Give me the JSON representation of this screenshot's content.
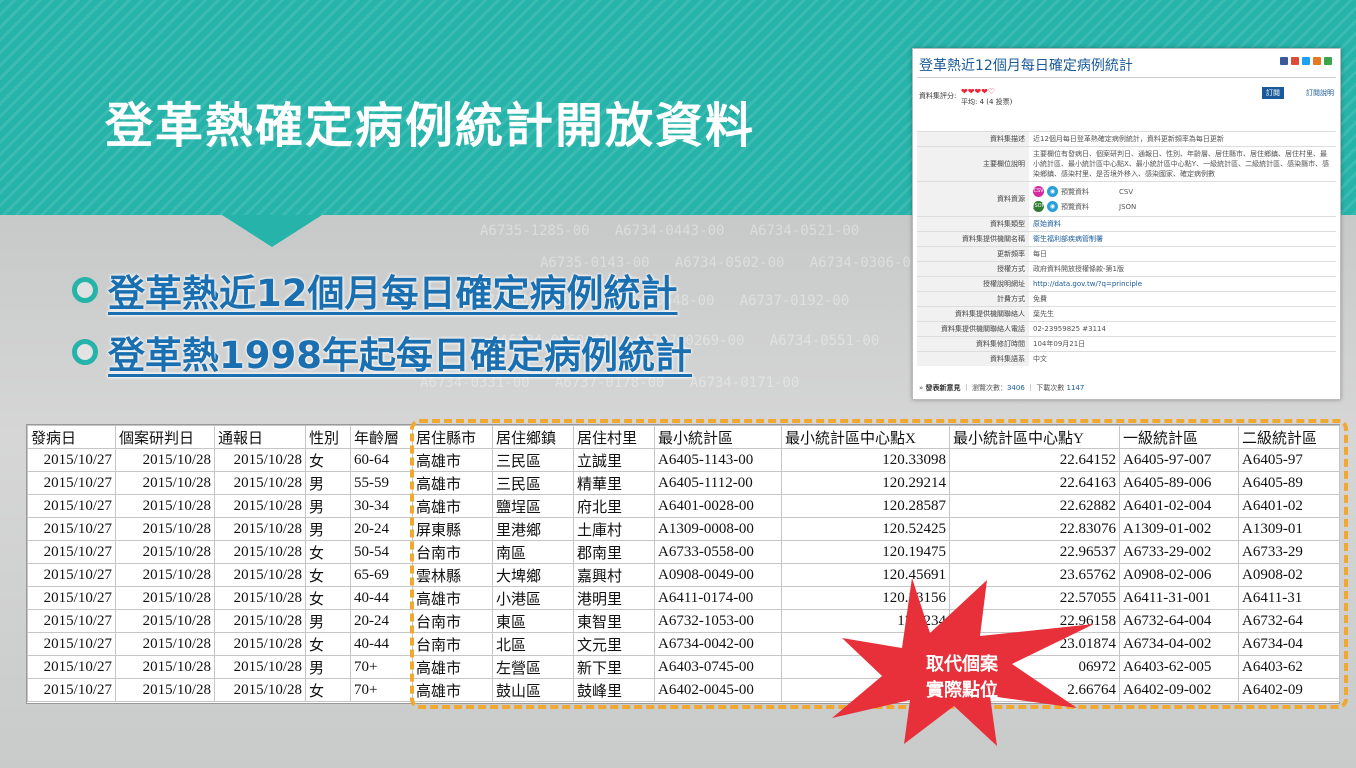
{
  "slide": {
    "title": "登革熱確定病例統計開放資料",
    "links": [
      "登革熱近12個月每日確定病例統計",
      "登革熱1998年起每日確定病例統計"
    ],
    "callout": [
      "取代個案",
      "實際點位"
    ],
    "colors": {
      "teal": "#26b3a9",
      "link": "#1a6fb0",
      "highlight_border": "#f0a830",
      "callout": "#e8303a"
    }
  },
  "dataset_panel": {
    "title": "登革熱近12個月每日確定病例統計",
    "rating_label": "資料集評分:",
    "rating_hearts": "❤❤❤❤♡",
    "rating_avg": "平均: 4 (4 投票)",
    "subscribe": "訂閱",
    "subscribe_help": "訂閱說明",
    "rows": [
      {
        "key": "資料集描述",
        "value": "近12個月每日登革熱確定病例統計，資料更新頻率為每日更新"
      },
      {
        "key": "主要欄位說明",
        "value": "主要欄位有發病日、個案研判日、通報日、性別、年齡層、居住縣市、居住鄉鎮、居住村里、最小統計區、最小統計區中心點X、最小統計區中心點Y、一級統計區、二級統計區、感染縣市、感染鄉鎮、感染村里、是否境外移入、感染國家、確定病例數"
      },
      {
        "key": "資料集類型",
        "value": "原始資料"
      },
      {
        "key": "資料集提供機關名稱",
        "value": "衛生福利部疾病管制署"
      },
      {
        "key": "更新頻率",
        "value": "每日"
      },
      {
        "key": "授權方式",
        "value": "政府資料開放授權條款-第1版"
      },
      {
        "key": "授權說明網址",
        "value": "http://data.gov.tw/?q=principle"
      },
      {
        "key": "計費方式",
        "value": "免費"
      },
      {
        "key": "資料集提供機關聯絡人",
        "value": "葉先生"
      },
      {
        "key": "資料集提供機關聯絡人電話",
        "value": "02-23959825 #3114"
      },
      {
        "key": "資料集修訂時間",
        "value": "104年09月21日"
      },
      {
        "key": "資料集語系",
        "value": "中文"
      }
    ],
    "resource_key": "資料資源",
    "resources": [
      {
        "badge": "CSV",
        "preview": "預覽資料",
        "format": "CSV"
      },
      {
        "badge": "JSON",
        "preview": "預覽資料",
        "format": "JSON"
      }
    ],
    "footer": {
      "comment": "發表新意見",
      "views_label": "瀏覽次數：",
      "views": "3406",
      "downloads_label": "下載次數",
      "downloads": "1147"
    }
  },
  "spreadsheet": {
    "headers": [
      "發病日",
      "個案研判日",
      "通報日",
      "性別",
      "年齡層",
      "居住縣市",
      "居住鄉鎮",
      "居住村里",
      "最小統計區",
      "最小統計區中心點X",
      "最小統計區中心點Y",
      "一級統計區",
      "二級統計區"
    ],
    "rows": [
      [
        "2015/10/27",
        "2015/10/28",
        "2015/10/28",
        "女",
        "60-64",
        "高雄市",
        "三民區",
        "立誠里",
        "A6405-1143-00",
        "120.33098",
        "22.64152",
        "A6405-97-007",
        "A6405-97"
      ],
      [
        "2015/10/27",
        "2015/10/28",
        "2015/10/28",
        "男",
        "55-59",
        "高雄市",
        "三民區",
        "精華里",
        "A6405-1112-00",
        "120.29214",
        "22.64163",
        "A6405-89-006",
        "A6405-89"
      ],
      [
        "2015/10/27",
        "2015/10/28",
        "2015/10/28",
        "男",
        "30-34",
        "高雄市",
        "鹽埕區",
        "府北里",
        "A6401-0028-00",
        "120.28587",
        "22.62882",
        "A6401-02-004",
        "A6401-02"
      ],
      [
        "2015/10/27",
        "2015/10/28",
        "2015/10/28",
        "男",
        "20-24",
        "屏東縣",
        "里港鄉",
        "土庫村",
        "A1309-0008-00",
        "120.52425",
        "22.83076",
        "A1309-01-002",
        "A1309-01"
      ],
      [
        "2015/10/27",
        "2015/10/28",
        "2015/10/28",
        "女",
        "50-54",
        "台南市",
        "南區",
        "郡南里",
        "A6733-0558-00",
        "120.19475",
        "22.96537",
        "A6733-29-002",
        "A6733-29"
      ],
      [
        "2015/10/27",
        "2015/10/28",
        "2015/10/28",
        "女",
        "65-69",
        "雲林縣",
        "大埤鄉",
        "嘉興村",
        "A0908-0049-00",
        "120.45691",
        "23.65762",
        "A0908-02-006",
        "A0908-02"
      ],
      [
        "2015/10/27",
        "2015/10/28",
        "2015/10/28",
        "女",
        "40-44",
        "高雄市",
        "小港區",
        "港明里",
        "A6411-0174-00",
        "120.33156",
        "22.57055",
        "A6411-31-001",
        "A6411-31"
      ],
      [
        "2015/10/27",
        "2015/10/28",
        "2015/10/28",
        "男",
        "20-24",
        "台南市",
        "東區",
        "東智里",
        "A6732-1053-00",
        "120.234",
        "22.96158",
        "A6732-64-004",
        "A6732-64"
      ],
      [
        "2015/10/27",
        "2015/10/28",
        "2015/10/28",
        "女",
        "40-44",
        "台南市",
        "北區",
        "文元里",
        "A6734-0042-00",
        "",
        "23.01874",
        "A6734-04-002",
        "A6734-04"
      ],
      [
        "2015/10/27",
        "2015/10/28",
        "2015/10/28",
        "男",
        "70+",
        "高雄市",
        "左營區",
        "新下里",
        "A6403-0745-00",
        "",
        "06972",
        "A6403-62-005",
        "A6403-62"
      ],
      [
        "2015/10/27",
        "2015/10/28",
        "2015/10/28",
        "女",
        "70+",
        "高雄市",
        "鼓山區",
        "鼓峰里",
        "A6402-0045-00",
        "",
        "2.66764",
        "A6402-09-002",
        "A6402-09"
      ]
    ]
  }
}
